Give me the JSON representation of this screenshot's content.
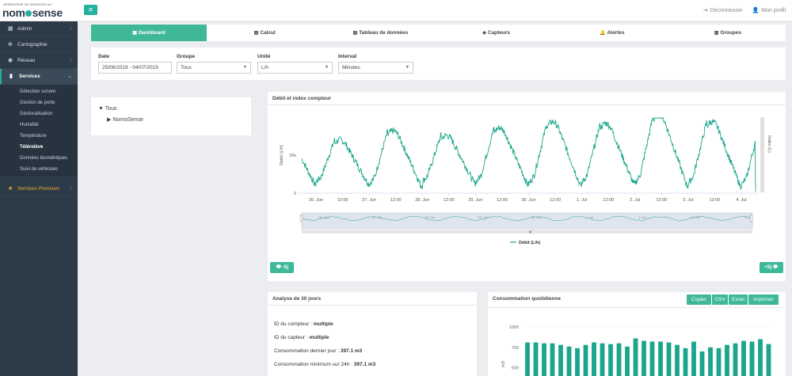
{
  "header": {
    "logo_sub": "OPÉRATEUR DE SERVICES IoT",
    "logo_part1": "nom",
    "logo_part2": "sense",
    "menu_icon": "≡",
    "logout_label": "Déconnexion",
    "profile_label": "Mon profil",
    "logout_icon": "⇥",
    "profile_icon": "👤"
  },
  "sidebar": {
    "items": [
      {
        "label": "Admin",
        "icon": "▦"
      },
      {
        "label": "Cartographie",
        "icon": "⊕"
      },
      {
        "label": "Réseau",
        "icon": "◉"
      },
      {
        "label": "Services",
        "icon": "▮"
      }
    ],
    "sub_items": [
      "Détection sonore",
      "Gestion de porte",
      "Géolocalisation",
      "Humidité",
      "Température",
      "Télérelève",
      "Données biométriques",
      "Suivi de véhicules"
    ],
    "current_sub": "Télérelève",
    "premium_label": "Services Premium",
    "premium_icon": "★"
  },
  "tabs": [
    {
      "label": "Dashboard",
      "icon": "▦",
      "active": true
    },
    {
      "label": "Calcul",
      "icon": "▤",
      "active": false
    },
    {
      "label": "Tableau de données",
      "icon": "▤",
      "active": false
    },
    {
      "label": "Capteurs",
      "icon": "◈",
      "active": false
    },
    {
      "label": "Alertes",
      "icon": "🔔",
      "active": false
    },
    {
      "label": "Groupes",
      "icon": "▥",
      "active": false
    }
  ],
  "filters": {
    "date_label": "Date",
    "date_value": "25/06/2019  -  04/07/2019",
    "groupe_label": "Groupe",
    "groupe_value": "Tous",
    "unite_label": "Unité",
    "unite_value": "L/h",
    "interval_label": "Interval",
    "interval_value": "Minutes"
  },
  "tree": {
    "root": "Tous",
    "child": "NomoSense"
  },
  "chart_panel": {
    "title": "Débit et index compteur",
    "prev_label": "🡄 -5j",
    "next_label": "+5j 🡆"
  },
  "analysis": {
    "title": "Analyse de 30 jours",
    "rows": [
      {
        "label": "ID du compteur : ",
        "value": "multiple"
      },
      {
        "label": "ID du capteur : ",
        "value": "multiple"
      },
      {
        "label": "Consommation dernier jour : ",
        "value": "397.1 m3"
      },
      {
        "label": "Consommation minimum sur 24h : ",
        "value": "397.1 m3"
      }
    ]
  },
  "conso": {
    "title": "Consommation quotidienne",
    "buttons": [
      "Copier",
      "CSV",
      "Excel",
      "Imprimer"
    ]
  },
  "chart_data": [
    {
      "type": "line",
      "title": "Débit et index compteur",
      "ylabel": "Débit (L/h)",
      "ylabel_right": "Index (L)",
      "ylim": [
        0,
        50000
      ],
      "yticks": [
        "0",
        "25k"
      ],
      "xticks": [
        "26. Jun",
        "12:00",
        "27. Jun",
        "12:00",
        "28. Jun",
        "12:00",
        "29. Jun",
        "12:00",
        "30. Jun",
        "12:00",
        "1. Jul",
        "12:00",
        "2. Jul",
        "12:00",
        "3. Jul",
        "12:00",
        "4. Jul"
      ],
      "series": [
        {
          "name": "Débit (L/h)",
          "color": "#1aa58c"
        }
      ],
      "daily_peaks": [
        38000,
        35000,
        41000,
        38000,
        43000,
        47000,
        46000,
        52000,
        47000,
        46000,
        42000
      ],
      "daily_mins": [
        5000,
        6000,
        4000,
        6000,
        5000,
        4000,
        5000,
        4000,
        4000,
        3000,
        2000
      ],
      "navigator_labels": [
        "26. Jun",
        "27. Jun",
        "28. Jun",
        "29. Jun",
        "30. Jun",
        "1. Jul",
        "2. Jul",
        "3. Jul",
        "4. Jul"
      ],
      "navigator_marker": "M"
    },
    {
      "type": "bar",
      "title": "Consommation quotidienne",
      "ylabel": "m3",
      "ylim": [
        0,
        1000
      ],
      "yticks": [
        "1000",
        "750",
        "500"
      ],
      "values": [
        810,
        810,
        800,
        800,
        780,
        760,
        740,
        780,
        810,
        800,
        790,
        800,
        760,
        860,
        830,
        820,
        820,
        810,
        780,
        740,
        820,
        700,
        750,
        740,
        780,
        800,
        830,
        820,
        850,
        790
      ],
      "color": "#1aa58c"
    }
  ]
}
